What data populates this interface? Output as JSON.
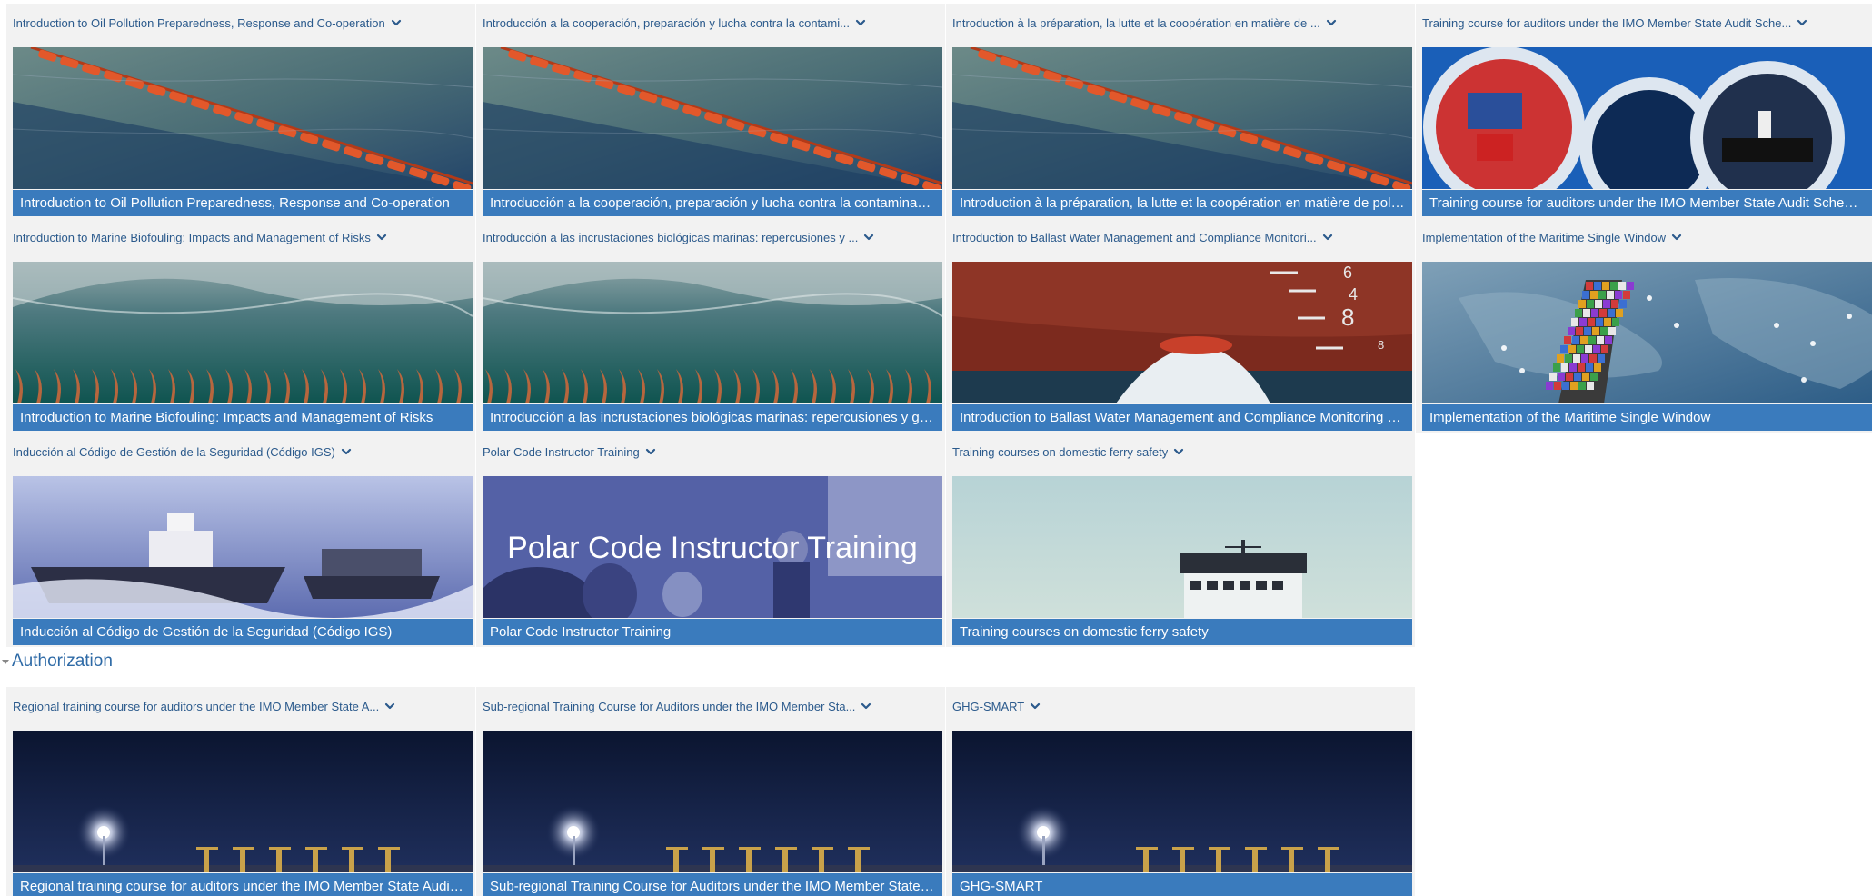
{
  "tiles": [
    {
      "title": "Introduction to Oil Pollution Preparedness, Response and Co-operation",
      "bar": "Introduction to Oil Pollution Preparedness, Response and Co-operation",
      "image": "oil-boom"
    },
    {
      "title": "Introducción a la cooperación, preparación y lucha contra la contami...",
      "bar": "Introducción a la cooperación, preparación y lucha contra la contaminació…",
      "image": "oil-boom"
    },
    {
      "title": "Introduction à la préparation, la lutte et la coopération en matière de ...",
      "bar": "Introduction à la préparation, la lutte et la coopération en matière de polluti…",
      "image": "oil-boom"
    },
    {
      "title": "Training course for auditors under the IMO Member State Audit Sche...",
      "bar": "Training course for auditors under the IMO Member State Audit Scheme (I…",
      "image": "audit-circles"
    },
    {
      "title": "Introduction to Marine Biofouling: Impacts and Management of Risks",
      "bar": "Introduction to Marine Biofouling: Impacts and Management of Risks",
      "image": "biofouling"
    },
    {
      "title": "Introducción a las incrustaciones biológicas marinas: repercusiones y ...",
      "bar": "Introducción a las incrustaciones biológicas marinas: repercusiones y gesti…",
      "image": "biofouling"
    },
    {
      "title": "Introduction to Ballast Water Management and Compliance Monitori...",
      "bar": "Introduction to Ballast Water Management and Compliance Monitoring and…",
      "image": "ballast"
    },
    {
      "title": "Implementation of the Maritime Single Window",
      "bar": "Implementation of the Maritime Single Window",
      "image": "single-window"
    },
    {
      "title": "Inducción al Código de Gestión de la Seguridad (Código IGS)",
      "bar": "Inducción al Código de Gestión de la Seguridad (Código IGS)",
      "image": "ism-ships"
    },
    {
      "title": "Polar Code Instructor Training",
      "bar": "Polar Code Instructor Training",
      "image": "polar",
      "overlay": "Polar Code Instructor Training"
    },
    {
      "title": "Training courses on domestic ferry safety",
      "bar": "Training courses on domestic ferry safety",
      "image": "ferry"
    },
    {
      "title": "Regional training course for auditors under the IMO Member State A...",
      "bar": "Regional training course for auditors under the IMO Member State Audit S…",
      "image": "port-night"
    },
    {
      "title": "Sub-regional Training Course for Auditors under the IMO Member Sta...",
      "bar": "Sub-regional Training Course for Auditors under the IMO Member State Au…",
      "image": "port-night"
    },
    {
      "title": "GHG-SMART",
      "bar": "GHG-SMART",
      "image": "port-night"
    }
  ],
  "section": {
    "label": "Authorization"
  },
  "icons": {
    "chevron": "chevron-down-icon",
    "collapse": "triangle-down-icon"
  },
  "colors": {
    "accent": "#3a7bbd",
    "title_link": "#2b5a8c",
    "tile_bg": "#f2f2f2"
  }
}
